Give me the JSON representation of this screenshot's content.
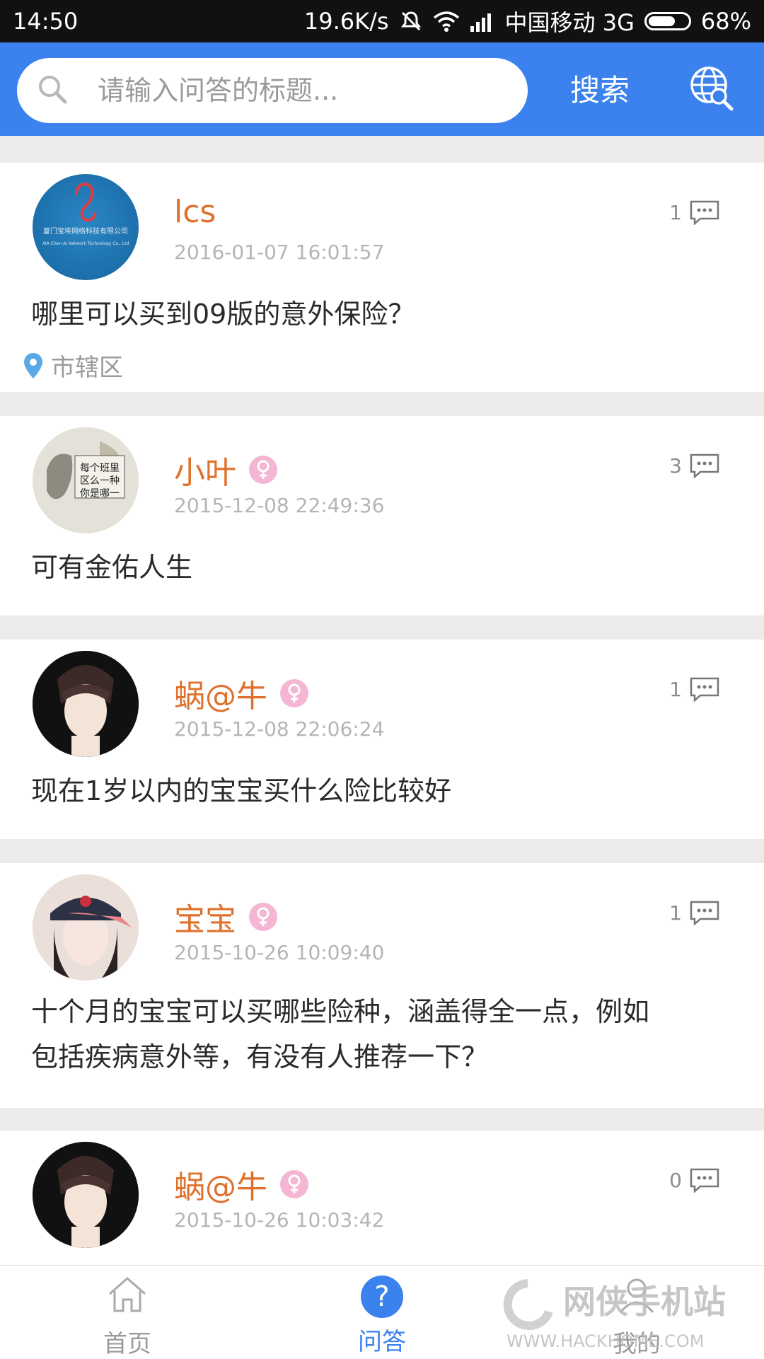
{
  "status_bar": {
    "time": "14:50",
    "speed": "19.6K/s",
    "carrier": "中国移动 3G",
    "battery": "68%",
    "battery_level": 0.68
  },
  "search": {
    "placeholder": "请输入问答的标题...",
    "button_label": "搜索"
  },
  "posts": [
    {
      "username": "lcs",
      "female": false,
      "time": "2016-01-07 16:01:57",
      "comments": "1",
      "question": "哪里可以买到09版的意外保险？",
      "location": "市辖区",
      "avatar_text": "厦门宝埃网络科技有限公司",
      "avatar_subtext": "XIA Chen Ai Network Technology Co., Ltd"
    },
    {
      "username": "小叶",
      "female": true,
      "time": "2015-12-08 22:49:36",
      "comments": "3",
      "question": "可有金佑人生"
    },
    {
      "username": "蜗@牛",
      "female": true,
      "time": "2015-12-08 22:06:24",
      "comments": "1",
      "question": "现在1岁以内的宝宝买什么险比较好"
    },
    {
      "username": "宝宝",
      "female": true,
      "time": "2015-10-26 10:09:40",
      "comments": "1",
      "question_line1": "十个月的宝宝可以买哪些险种，涵盖得全一点，例如",
      "question_line2": "包括疾病意外等，有没有人推荐一下？"
    },
    {
      "username": "蜗@牛",
      "female": true,
      "time": "2015-10-26 10:03:42",
      "comments": "0"
    }
  ],
  "nav": {
    "home": "首页",
    "qa": "问答",
    "mine": "我的",
    "active": "qa"
  },
  "watermark": {
    "brand": "网侠手机站",
    "url": "WWW.HACKHOME.COM"
  },
  "colors": {
    "accent": "#3b82ee",
    "username": "#e0702b",
    "female_badge": "#f4b6d3"
  },
  "icons": [
    "search-icon",
    "globe-search-icon",
    "comment-icon",
    "location-pin-icon",
    "female-icon",
    "home-icon",
    "question-icon",
    "user-icon"
  ]
}
